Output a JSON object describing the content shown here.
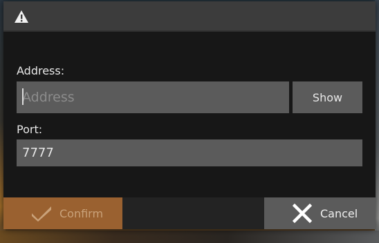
{
  "dialog": {
    "title_icon": "warning-icon",
    "address": {
      "label": "Address:",
      "placeholder": "Address",
      "value": ""
    },
    "show_button": "Show",
    "port": {
      "label": "Port:",
      "value": "7777"
    },
    "confirm": {
      "label": "Confirm",
      "icon": "check-icon",
      "enabled": false
    },
    "cancel": {
      "label": "Cancel",
      "icon": "close-icon"
    }
  },
  "colors": {
    "accent": "#9a6130",
    "panel": "#171717",
    "field": "#5b5b5b",
    "titlebar": "#3c3c3c"
  }
}
